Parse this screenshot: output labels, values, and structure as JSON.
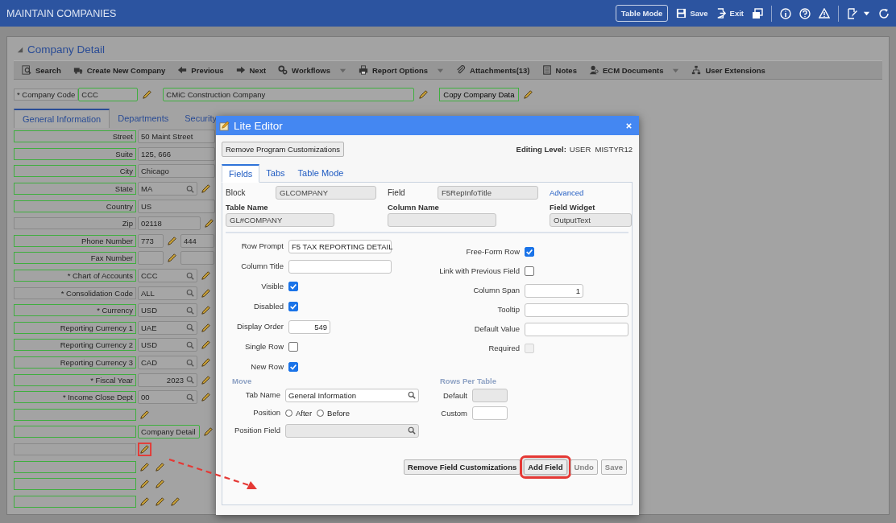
{
  "window": {
    "title": "MAINTAIN COMPANIES"
  },
  "top_actions": [
    {
      "label": "Table Mode",
      "kind": "button"
    },
    {
      "label": "Save",
      "kind": "save"
    },
    {
      "label": "Exit",
      "kind": "exit"
    }
  ],
  "section_title": "Company Detail",
  "toolbar": [
    {
      "label": "Search",
      "kind": "search",
      "dropdown": false
    },
    {
      "label": "Create New Company",
      "kind": "new",
      "dropdown": false
    },
    {
      "label": "Previous",
      "kind": "previous",
      "dropdown": false
    },
    {
      "label": "Next",
      "kind": "next",
      "dropdown": false
    },
    {
      "label": "Workflows",
      "kind": "workflow",
      "dropdown": true
    },
    {
      "label": "Report Options",
      "kind": "print",
      "dropdown": true
    },
    {
      "label": "Attachments(13)",
      "kind": "attach",
      "dropdown": false
    },
    {
      "label": "Notes",
      "kind": "notes",
      "dropdown": false
    },
    {
      "label": "ECM Documents",
      "kind": "documents",
      "dropdown": true
    },
    {
      "label": "User Extensions",
      "kind": "extensions",
      "dropdown": false
    }
  ],
  "company_code": {
    "label": "* Company Code",
    "code": "CCC",
    "name": "CMiC Construction Company",
    "copy_button": "Copy Company Data"
  },
  "tabs": [
    {
      "label": "General Information",
      "selected": true
    },
    {
      "label": "Departments",
      "selected": false
    },
    {
      "label": "Security",
      "selected": false
    }
  ],
  "form_rows": [
    {
      "label": "Street",
      "kind": "text",
      "value": "50 Maint Street",
      "outlined": true,
      "pencils": []
    },
    {
      "label": "Suite",
      "kind": "text",
      "value": "125, 666",
      "outlined": true,
      "pencils": []
    },
    {
      "label": "City",
      "kind": "text",
      "value": "Chicago",
      "outlined": true,
      "pencils": []
    },
    {
      "label": "State",
      "kind": "lookup",
      "value": "MA",
      "outlined": true,
      "pencils": [
        {
          "highlighted": false
        }
      ]
    },
    {
      "label": "Country",
      "kind": "text",
      "value": "US",
      "outlined": true,
      "pencils": []
    },
    {
      "label": "Zip",
      "kind": "zip",
      "value": "02118",
      "outlined": false,
      "pencils": [
        {
          "highlighted": false
        }
      ]
    },
    {
      "label": "Phone Number",
      "kind": "split",
      "value": "773",
      "value2": "444",
      "outlined": true,
      "pencils": [
        {
          "highlighted": false
        }
      ]
    },
    {
      "label": "Fax Number",
      "kind": "split",
      "outlined": true,
      "pencils": [
        {
          "highlighted": false
        }
      ]
    },
    {
      "label": "* Chart of Accounts",
      "kind": "lookup",
      "value": "CCC",
      "outlined": true,
      "pencils": [
        {
          "highlighted": false
        }
      ]
    },
    {
      "label": "* Consolidation Code",
      "kind": "lookup",
      "value": "ALL",
      "outlined": false,
      "pencils": [
        {
          "highlighted": false
        }
      ]
    },
    {
      "label": "* Currency",
      "kind": "lookup",
      "value": "USD",
      "outlined": true,
      "pencils": [
        {
          "highlighted": false
        }
      ]
    },
    {
      "label": "Reporting Currency 1",
      "kind": "lookup",
      "value": "UAE",
      "outlined": true,
      "pencils": [
        {
          "highlighted": false
        }
      ]
    },
    {
      "label": "Reporting Currency 2",
      "kind": "lookup",
      "value": "USD",
      "outlined": true,
      "pencils": [
        {
          "highlighted": false
        }
      ]
    },
    {
      "label": "Reporting Currency 3",
      "kind": "lookup",
      "value": "CAD",
      "outlined": true,
      "pencils": [
        {
          "highlighted": false
        }
      ]
    },
    {
      "label": "* Fiscal Year",
      "kind": "lookup-numeric",
      "value": "2023",
      "outlined": true,
      "pencils": [
        {
          "highlighted": false
        }
      ]
    },
    {
      "label": "* Income Close Dept",
      "kind": "lookup",
      "value": "00",
      "outlined": true,
      "pencils": [
        {
          "highlighted": false
        }
      ]
    },
    {
      "kind": "blank",
      "outlined": true,
      "pencils": [
        {
          "highlighted": false
        }
      ]
    },
    {
      "kind": "button",
      "value": "Company Detail",
      "outlined": true,
      "pencils": [
        {
          "highlighted": false
        }
      ]
    },
    {
      "kind": "blank",
      "outlined": false,
      "pencils": [
        {
          "highlighted": true
        }
      ]
    },
    {
      "kind": "blank",
      "outlined": true,
      "pencils": [
        {
          "highlighted": false
        },
        {
          "highlighted": false
        }
      ]
    },
    {
      "kind": "blank",
      "outlined": true,
      "pencils": [
        {
          "highlighted": false
        },
        {
          "highlighted": false
        }
      ]
    },
    {
      "kind": "blank",
      "outlined": true,
      "pencils": [
        {
          "highlighted": false
        },
        {
          "highlighted": false
        },
        {
          "highlighted": false
        }
      ]
    }
  ],
  "lite_editor": {
    "title": "Lite Editor",
    "remove_program_button": "Remove Program Customizations",
    "editing_level_label": "Editing Level:",
    "editing_level_value": "USER  MISTYR12",
    "tabs": [
      {
        "label": "Fields",
        "selected": true
      },
      {
        "label": "Tabs",
        "selected": false
      },
      {
        "label": "Table Mode",
        "selected": false
      }
    ],
    "block": {
      "label": "Block",
      "value": "GLCOMPANY"
    },
    "field": {
      "label": "Field",
      "value": "F5RepInfoTitle"
    },
    "advanced_link": "Advanced",
    "table_name": {
      "label": "Table Name",
      "value": "GL#COMPANY"
    },
    "column_name": {
      "label": "Column Name"
    },
    "field_widget": {
      "label": "Field Widget",
      "value": "OutputText"
    },
    "left_options": [
      {
        "label": "Row Prompt",
        "kind": "text",
        "value": "F5 TAX REPORTING DETAIL"
      },
      {
        "label": "Column Title",
        "kind": "text"
      },
      {
        "label": "Visible",
        "kind": "check",
        "checked": true,
        "disabled": false
      },
      {
        "label": "Disabled",
        "kind": "check",
        "checked": true,
        "disabled": false
      },
      {
        "label": "Display Order",
        "kind": "number",
        "value": "549"
      },
      {
        "label": "Single Row",
        "kind": "check",
        "checked": false,
        "disabled": false
      },
      {
        "label": "New Row",
        "kind": "check",
        "checked": true,
        "disabled": false
      }
    ],
    "right_options": [
      {
        "label": "Free-Form Row",
        "kind": "check",
        "checked": true,
        "disabled": false
      },
      {
        "label": "Link with Previous Field",
        "kind": "check",
        "checked": false,
        "disabled": false
      },
      {
        "label": "Column Span",
        "kind": "number",
        "value": "1"
      },
      {
        "label": "Tooltip",
        "kind": "text"
      },
      {
        "label": "Default Value",
        "kind": "text"
      },
      {
        "label": "Required",
        "kind": "check",
        "checked": false,
        "disabled": true
      }
    ],
    "move": {
      "heading": "Move",
      "tab_name": {
        "label": "Tab Name",
        "value": "General Information"
      },
      "position": {
        "label": "Position",
        "options": [
          {
            "label": "After",
            "selected": false
          },
          {
            "label": "Before",
            "selected": false
          }
        ]
      },
      "position_field": {
        "label": "Position Field"
      }
    },
    "rows_per_table": {
      "heading": "Rows Per Table",
      "default_label": "Default",
      "custom_label": "Custom"
    },
    "buttons": [
      {
        "label": "Remove Field Customizations",
        "disabled": false,
        "highlighted": false
      },
      {
        "label": "Add Field",
        "disabled": false,
        "highlighted": true
      },
      {
        "label": "Undo",
        "disabled": true,
        "highlighted": false
      },
      {
        "label": "Save",
        "disabled": true,
        "highlighted": false
      }
    ]
  }
}
